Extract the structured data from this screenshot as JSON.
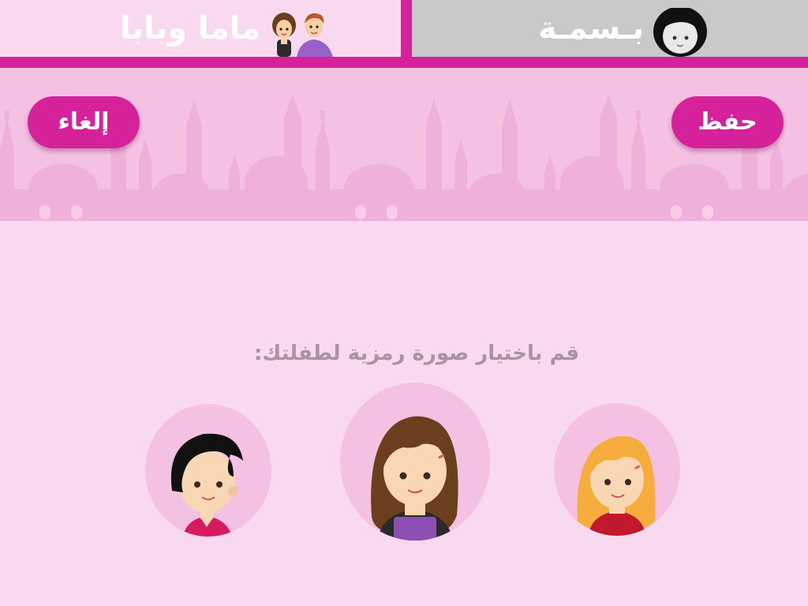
{
  "tabs": {
    "parents": {
      "label": "ماما وبابا",
      "icon": "parents-icon"
    },
    "child": {
      "label": "بـسمـة",
      "icon": "girl-avatar-icon",
      "selected": true
    }
  },
  "toolbar": {
    "cancel_label": "إلغاء",
    "save_label": "حفظ"
  },
  "main": {
    "prompt": "قم باختيار صورة رمزية لطفلتك:",
    "avatars": [
      {
        "icon": "black-hair-girl-avatar"
      },
      {
        "icon": "brown-hair-girl-avatar"
      },
      {
        "icon": "blonde-girl-avatar"
      }
    ]
  },
  "colors": {
    "accent": "#d6229a",
    "background": "#f9d9ef",
    "header_band": "#f4c1e3",
    "inactive_tab": "#c9c9c9",
    "prompt_text": "#a7959f"
  }
}
